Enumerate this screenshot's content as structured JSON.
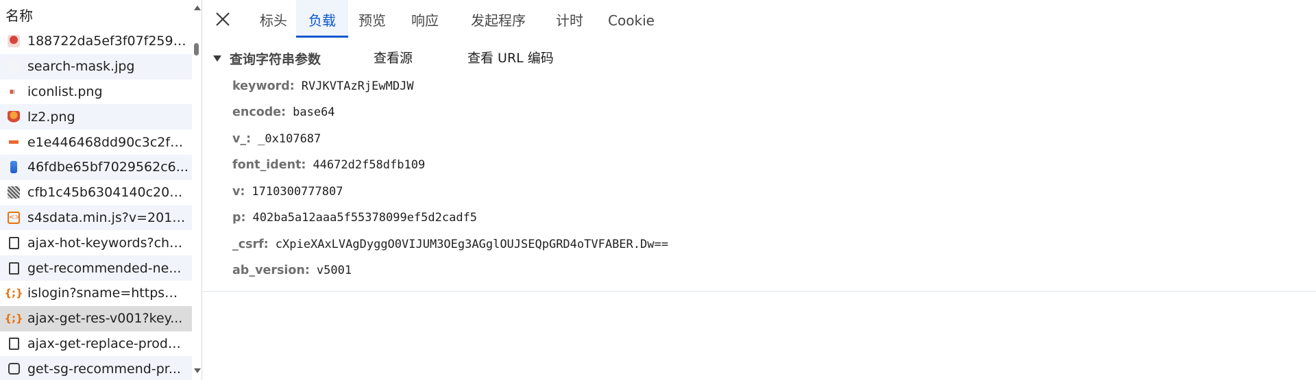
{
  "request_list": {
    "header": "名称",
    "items": [
      {
        "name": "188722da5ef3f07f259b...",
        "icon": "image-thumbnail-icon"
      },
      {
        "name": "search-mask.jpg",
        "icon": "image-thumbnail-icon"
      },
      {
        "name": "iconlist.png",
        "icon": "image-thumbnail-icon"
      },
      {
        "name": "lz2.png",
        "icon": "image-thumbnail-icon"
      },
      {
        "name": "e1e446468dd90c3c2f6...",
        "icon": "image-thumbnail-icon"
      },
      {
        "name": "46fdbe65bf7029562c6...",
        "icon": "image-thumbnail-icon"
      },
      {
        "name": "cfb1c45b6304140c206...",
        "icon": "image-thumbnail-icon"
      },
      {
        "name": "s4sdata.min.js?v=2019...",
        "icon": "script-icon"
      },
      {
        "name": "ajax-hot-keywords?cha...",
        "icon": "document-icon"
      },
      {
        "name": "get-recommended-ne...",
        "icon": "document-icon"
      },
      {
        "name": "islogin?sname=https%...",
        "icon": "xhr-icon"
      },
      {
        "name": "ajax-get-res-v001?key...",
        "icon": "xhr-icon",
        "selected": true
      },
      {
        "name": "ajax-get-replace-produ...",
        "icon": "document-icon"
      },
      {
        "name": "get-sg-recommend-pr...",
        "icon": "checkbox-icon"
      }
    ]
  },
  "tabs": [
    {
      "label": "标头"
    },
    {
      "label": "负载",
      "active": true
    },
    {
      "label": "预览"
    },
    {
      "label": "响应"
    },
    {
      "label": "发起程序"
    },
    {
      "label": "计时"
    },
    {
      "label": "Cookie"
    }
  ],
  "payload": {
    "section_title": "查询字符串参数",
    "view_source": "查看源",
    "view_url_encoded": "查看 URL 编码",
    "params": [
      {
        "key": "keyword:",
        "value": "RVJKVTAzRjEwMDJW"
      },
      {
        "key": "encode:",
        "value": "base64"
      },
      {
        "key": "v_:",
        "value": "_0x107687"
      },
      {
        "key": "font_ident:",
        "value": "44672d2f58dfb109"
      },
      {
        "key": "v:",
        "value": "1710300777807"
      },
      {
        "key": "p:",
        "value": "402ba5a12aaa5f55378099ef5d2cadf5"
      },
      {
        "key": "_csrf:",
        "value": "cXpieXAxLVAgDyggO0VIJUM3OEg3AGglOUJSEQpGRD4oTVFABER.Dw=="
      },
      {
        "key": "ab_version:",
        "value": "v5001"
      }
    ]
  },
  "colors": {
    "accent": "#0b57d0",
    "xhr": "#e8710a",
    "selected_row": "#dcdcdc"
  }
}
